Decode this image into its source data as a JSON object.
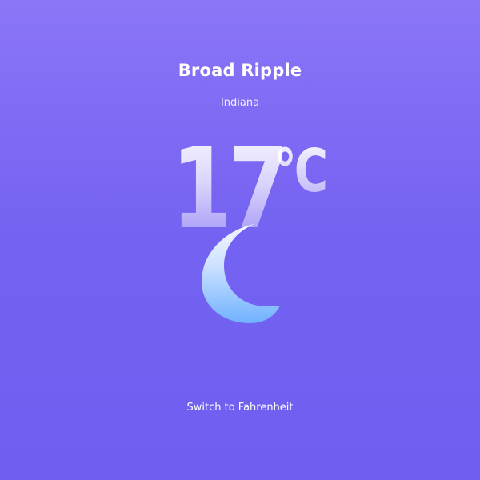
{
  "location": {
    "city": "Broad Ripple",
    "region": "Indiana"
  },
  "weather": {
    "temperature": "17",
    "unit": "°C",
    "condition_icon": "crescent-moon-icon"
  },
  "controls": {
    "switch_unit_label": "Switch to Fahrenheit"
  },
  "colors": {
    "background_top": "#8b76f7",
    "background_bottom": "#6f5ef0",
    "moon_top": "#e6f0ff",
    "moon_bottom": "#6fb1ff"
  }
}
